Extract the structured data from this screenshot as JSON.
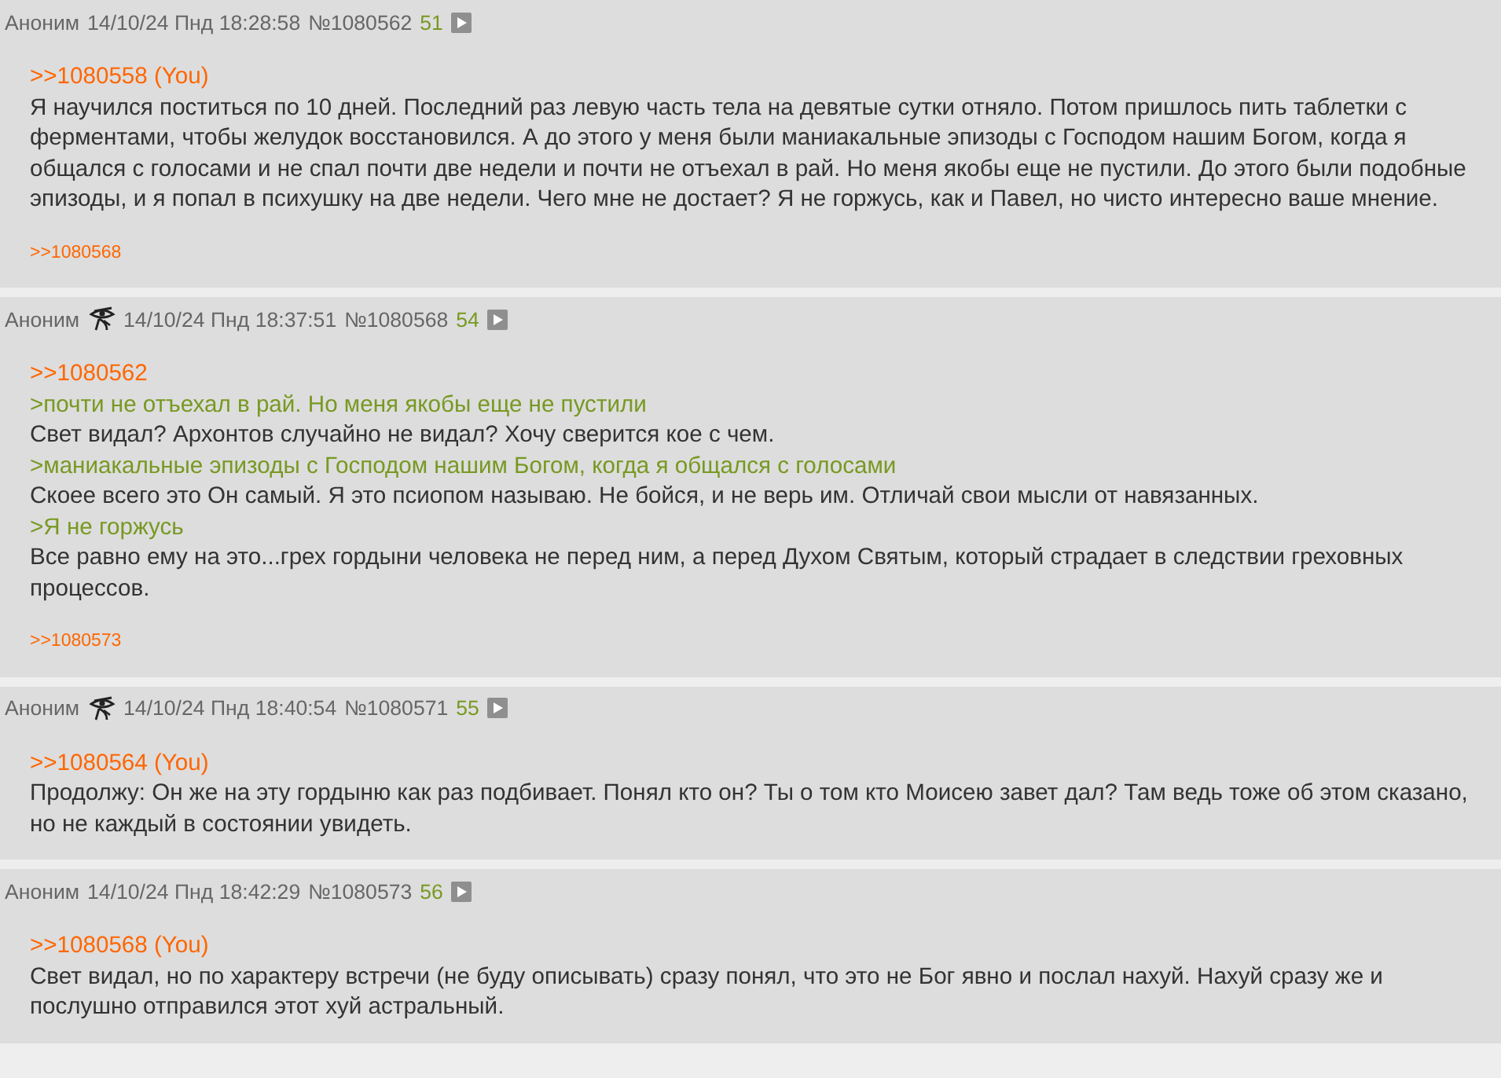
{
  "posts": [
    {
      "author": "Аноним",
      "eye_mark": false,
      "date": "14/10/24 Пнд 18:28:58",
      "number": "№1080562",
      "count": "51",
      "link": ">>1080558 (You)",
      "lines": [
        {
          "kind": "text",
          "text": "Я научился поститься по 10 дней. Последний раз левую часть тела на девятые сутки отняло. Потом пришлось пить таблетки с ферментами, чтобы желудок восстановился. А до этого у меня были маниакальные эпизоды с Господом нашим Богом, когда я общался с голосами и не спал почти две недели и почти не отъехал в рай. Но меня якобы еще не пустили. До этого были подобные эпизоды, и я попал в психушку на две недели. Чего мне не достает? Я не горжусь, как и Павел, но чисто интересно ваше мнение."
        }
      ],
      "replies": [
        ">>1080568"
      ]
    },
    {
      "author": "Аноним",
      "eye_mark": true,
      "date": "14/10/24 Пнд 18:37:51",
      "number": "№1080568",
      "count": "54",
      "link": ">>1080562",
      "lines": [
        {
          "kind": "quote",
          "text": ">почти не отъехал в рай. Но меня якобы еще не пустили"
        },
        {
          "kind": "text",
          "text": "Свет видал? Архонтов случайно не видал? Хочу сверится кое с чем."
        },
        {
          "kind": "quote",
          "text": ">маниакальные эпизоды с Господом нашим Богом, когда я общался с голосами"
        },
        {
          "kind": "text",
          "text": "Скоее всего это Он самый. Я это псиопом называю. Не бойся, и не верь им. Отличай свои мысли от навязанных."
        },
        {
          "kind": "quote",
          "text": ">Я не горжусь"
        },
        {
          "kind": "text",
          "text": "Все равно ему на это...грех гордыни человека не перед ним, а перед Духом Святым, который страдает в следствии греховных процессов."
        }
      ],
      "replies": [
        ">>1080573"
      ]
    },
    {
      "author": "Аноним",
      "eye_mark": true,
      "date": "14/10/24 Пнд 18:40:54",
      "number": "№1080571",
      "count": "55",
      "link": ">>1080564 (You)",
      "lines": [
        {
          "kind": "text",
          "text": "Продолжу: Он же на эту гордыню как раз подбивает. Понял кто он? Ты о том кто Моисею завет дал? Там ведь тоже об этом сказано, но не каждый в состоянии увидеть."
        }
      ]
    },
    {
      "author": "Аноним",
      "eye_mark": false,
      "date": "14/10/24 Пнд 18:42:29",
      "number": "№1080573",
      "count": "56",
      "link": ">>1080568 (You)",
      "lines": [
        {
          "kind": "text",
          "text": "Свет видал, но по характеру встречи (не буду описывать) сразу понял, что это не Бог явно и послал нахуй. Нахуй сразу же и послушно отправился этот хуй астральный."
        }
      ]
    }
  ]
}
